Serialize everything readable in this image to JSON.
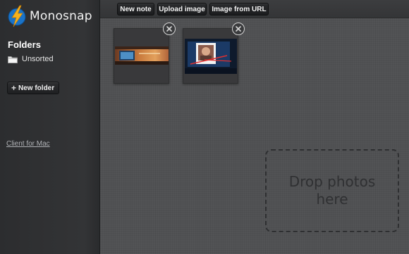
{
  "app": {
    "name": "Monosnap"
  },
  "sidebar": {
    "folders_heading": "Folders",
    "folders": [
      {
        "label": "Unsorted",
        "icon": "folder-icon"
      }
    ],
    "new_folder_label": "New folder",
    "client_link": "Client for Mac"
  },
  "toolbar": {
    "new_note": "New note",
    "upload_image": "Upload image",
    "image_from_url": "Image from URL"
  },
  "gallery": {
    "items": [
      {
        "name": "screenshot-thumbnail-1",
        "remove_icon": "close-icon"
      },
      {
        "name": "screenshot-thumbnail-2",
        "remove_icon": "close-icon"
      }
    ]
  },
  "dropzone": {
    "text": "Drop photos here"
  },
  "colors": {
    "sidebar_bg": "#333436",
    "main_bg": "#505153",
    "toolbar_button": "#1f2022",
    "logo_bolt": "#f6b21c",
    "logo_circle": "#1a73c8"
  }
}
